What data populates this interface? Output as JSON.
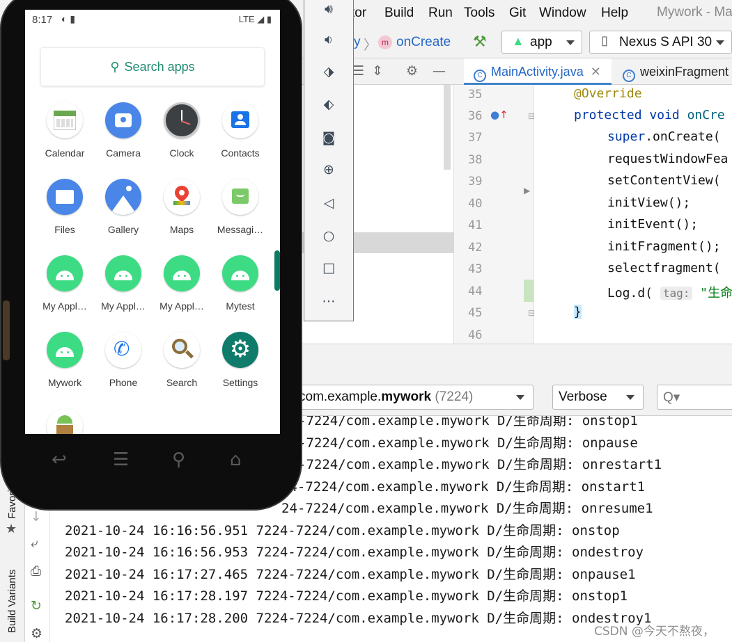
{
  "ide": {
    "title": "Mywork - Ma",
    "menu": [
      "tor",
      "Build",
      "Run",
      "Tools",
      "Git",
      "Window",
      "Help"
    ],
    "breadcrumb": {
      "frag": "y",
      "method": "onCreate"
    },
    "run_config": "app",
    "device": "Nexus S API 30",
    "tabs": [
      {
        "label": "MainActivity.java",
        "active": true
      },
      {
        "label": "weixinFragment",
        "active": false
      }
    ],
    "editor": {
      "line_numbers": [
        "35",
        "36",
        "37",
        "38",
        "39",
        "40",
        "41",
        "42",
        "43",
        "44",
        "45",
        "46"
      ],
      "lines": {
        "l35": "@Override",
        "l36_kw": "protected void ",
        "l36_fn": "onCre",
        "l37_kw": "super",
        "l37_rest": ".onCreate(",
        "l38": "requestWindowFea",
        "l39": "setContentView(",
        "l40": "initView();",
        "l41": "initEvent();",
        "l42": "initFragment();",
        "l43": "selectfragment(",
        "l44_pre": "Log.d( ",
        "l44_hint": "tag:",
        "l44_str": " \"生命周",
        "l45": "}"
      }
    },
    "logcat": {
      "process": "com.example.",
      "process_bold": "mywork",
      "pid": "(7224)",
      "level": "Verbose",
      "search_placeholder": "Q▾",
      "lines": [
        "-7224/com.example.mywork D/生命周期: onstop1",
        "-7224/com.example.mywork D/生命周期: onpause",
        "-7224/com.example.mywork D/生命周期: onrestart1",
        "24-7224/com.example.mywork D/生命周期: onstart1",
        "24-7224/com.example.mywork D/生命周期: onresume1",
        "2021-10-24 16:16:56.951 7224-7224/com.example.mywork D/生命周期: onstop",
        "2021-10-24 16:16:56.953 7224-7224/com.example.mywork D/生命周期: ondestroy",
        "2021-10-24 16:17:27.465 7224-7224/com.example.mywork D/生命周期: onpause1",
        "2021-10-24 16:17:28.197 7224-7224/com.example.mywork D/生命周期: onstop1",
        "2021-10-24 16:17:28.200 7224-7224/com.example.mywork D/生命周期: ondestroy1"
      ]
    },
    "side_labels": {
      "favorites": "Favori",
      "build_variants": "Build Variants"
    },
    "watermark": "CSDN @今天不熬夜，"
  },
  "emulator_toolbar": [
    "volume-up-icon",
    "volume-down-icon",
    "rotate-left-icon",
    "rotate-right-icon",
    "camera-icon",
    "zoom-icon",
    "back-icon",
    "home-icon",
    "overview-icon",
    "more-icon"
  ],
  "phone": {
    "time": "8:17",
    "network": "LTE",
    "search_label": "Search apps",
    "apps": [
      {
        "label": "Calendar"
      },
      {
        "label": "Camera"
      },
      {
        "label": "Clock"
      },
      {
        "label": "Contacts"
      },
      {
        "label": "Files"
      },
      {
        "label": "Gallery"
      },
      {
        "label": "Maps"
      },
      {
        "label": "Messagi…"
      },
      {
        "label": "My Appl…"
      },
      {
        "label": "My Appl…"
      },
      {
        "label": "My Appl…"
      },
      {
        "label": "Mytest"
      },
      {
        "label": "Mywork"
      },
      {
        "label": "Phone"
      },
      {
        "label": "Search"
      },
      {
        "label": "Settings"
      }
    ]
  },
  "colors": {
    "accent": "#2467c7",
    "android_green": "#3ddc84",
    "teal": "#1f8a70"
  }
}
